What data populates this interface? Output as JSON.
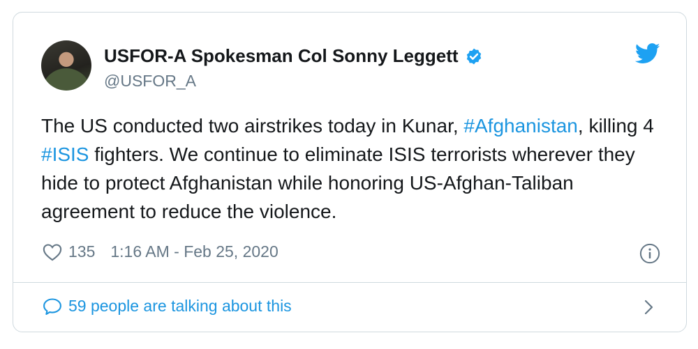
{
  "tweet": {
    "author_name": "USFOR-A Spokesman Col Sonny Leggett",
    "handle": "@USFOR_A",
    "text_parts": {
      "p1": "The US conducted two airstrikes today in Kunar, ",
      "tag1": "#Afghanistan",
      "p2": ", killing 4 ",
      "tag2": "#ISIS",
      "p3": " fighters. We continue to eliminate ISIS terrorists wherever they hide to protect Afghanistan while honoring US-Afghan-Taliban agreement to reduce the violence."
    },
    "likes": "135",
    "timestamp": "1:16 AM - Feb 25, 2020",
    "conversation": "59 people are talking about this"
  },
  "icons": {
    "verified": "verified-badge-icon",
    "twitter": "twitter-bird-icon",
    "like": "heart-icon",
    "info": "info-icon",
    "reply": "speech-bubble-icon",
    "more": "chevron-right-icon"
  },
  "colors": {
    "accent": "#1b95e0",
    "secondary_text": "#657786",
    "border": "#cfd9de",
    "twitter_blue": "#1da1f2"
  }
}
